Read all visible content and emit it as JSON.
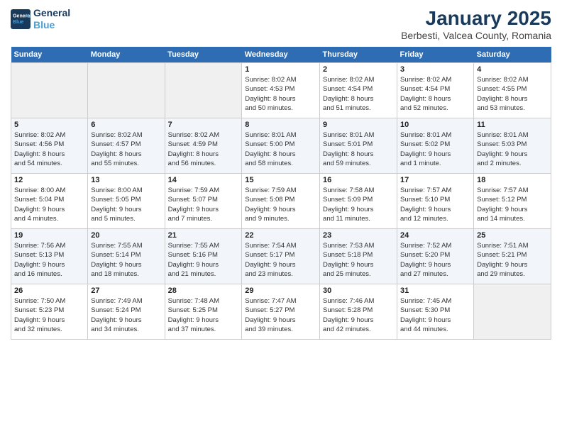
{
  "header": {
    "logo_line1": "General",
    "logo_line2": "Blue",
    "title": "January 2025",
    "subtitle": "Berbesti, Valcea County, Romania"
  },
  "weekdays": [
    "Sunday",
    "Monday",
    "Tuesday",
    "Wednesday",
    "Thursday",
    "Friday",
    "Saturday"
  ],
  "weeks": [
    [
      {
        "day": "",
        "info": ""
      },
      {
        "day": "",
        "info": ""
      },
      {
        "day": "",
        "info": ""
      },
      {
        "day": "1",
        "info": "Sunrise: 8:02 AM\nSunset: 4:53 PM\nDaylight: 8 hours\nand 50 minutes."
      },
      {
        "day": "2",
        "info": "Sunrise: 8:02 AM\nSunset: 4:54 PM\nDaylight: 8 hours\nand 51 minutes."
      },
      {
        "day": "3",
        "info": "Sunrise: 8:02 AM\nSunset: 4:54 PM\nDaylight: 8 hours\nand 52 minutes."
      },
      {
        "day": "4",
        "info": "Sunrise: 8:02 AM\nSunset: 4:55 PM\nDaylight: 8 hours\nand 53 minutes."
      }
    ],
    [
      {
        "day": "5",
        "info": "Sunrise: 8:02 AM\nSunset: 4:56 PM\nDaylight: 8 hours\nand 54 minutes."
      },
      {
        "day": "6",
        "info": "Sunrise: 8:02 AM\nSunset: 4:57 PM\nDaylight: 8 hours\nand 55 minutes."
      },
      {
        "day": "7",
        "info": "Sunrise: 8:02 AM\nSunset: 4:59 PM\nDaylight: 8 hours\nand 56 minutes."
      },
      {
        "day": "8",
        "info": "Sunrise: 8:01 AM\nSunset: 5:00 PM\nDaylight: 8 hours\nand 58 minutes."
      },
      {
        "day": "9",
        "info": "Sunrise: 8:01 AM\nSunset: 5:01 PM\nDaylight: 8 hours\nand 59 minutes."
      },
      {
        "day": "10",
        "info": "Sunrise: 8:01 AM\nSunset: 5:02 PM\nDaylight: 9 hours\nand 1 minute."
      },
      {
        "day": "11",
        "info": "Sunrise: 8:01 AM\nSunset: 5:03 PM\nDaylight: 9 hours\nand 2 minutes."
      }
    ],
    [
      {
        "day": "12",
        "info": "Sunrise: 8:00 AM\nSunset: 5:04 PM\nDaylight: 9 hours\nand 4 minutes."
      },
      {
        "day": "13",
        "info": "Sunrise: 8:00 AM\nSunset: 5:05 PM\nDaylight: 9 hours\nand 5 minutes."
      },
      {
        "day": "14",
        "info": "Sunrise: 7:59 AM\nSunset: 5:07 PM\nDaylight: 9 hours\nand 7 minutes."
      },
      {
        "day": "15",
        "info": "Sunrise: 7:59 AM\nSunset: 5:08 PM\nDaylight: 9 hours\nand 9 minutes."
      },
      {
        "day": "16",
        "info": "Sunrise: 7:58 AM\nSunset: 5:09 PM\nDaylight: 9 hours\nand 11 minutes."
      },
      {
        "day": "17",
        "info": "Sunrise: 7:57 AM\nSunset: 5:10 PM\nDaylight: 9 hours\nand 12 minutes."
      },
      {
        "day": "18",
        "info": "Sunrise: 7:57 AM\nSunset: 5:12 PM\nDaylight: 9 hours\nand 14 minutes."
      }
    ],
    [
      {
        "day": "19",
        "info": "Sunrise: 7:56 AM\nSunset: 5:13 PM\nDaylight: 9 hours\nand 16 minutes."
      },
      {
        "day": "20",
        "info": "Sunrise: 7:55 AM\nSunset: 5:14 PM\nDaylight: 9 hours\nand 18 minutes."
      },
      {
        "day": "21",
        "info": "Sunrise: 7:55 AM\nSunset: 5:16 PM\nDaylight: 9 hours\nand 21 minutes."
      },
      {
        "day": "22",
        "info": "Sunrise: 7:54 AM\nSunset: 5:17 PM\nDaylight: 9 hours\nand 23 minutes."
      },
      {
        "day": "23",
        "info": "Sunrise: 7:53 AM\nSunset: 5:18 PM\nDaylight: 9 hours\nand 25 minutes."
      },
      {
        "day": "24",
        "info": "Sunrise: 7:52 AM\nSunset: 5:20 PM\nDaylight: 9 hours\nand 27 minutes."
      },
      {
        "day": "25",
        "info": "Sunrise: 7:51 AM\nSunset: 5:21 PM\nDaylight: 9 hours\nand 29 minutes."
      }
    ],
    [
      {
        "day": "26",
        "info": "Sunrise: 7:50 AM\nSunset: 5:23 PM\nDaylight: 9 hours\nand 32 minutes."
      },
      {
        "day": "27",
        "info": "Sunrise: 7:49 AM\nSunset: 5:24 PM\nDaylight: 9 hours\nand 34 minutes."
      },
      {
        "day": "28",
        "info": "Sunrise: 7:48 AM\nSunset: 5:25 PM\nDaylight: 9 hours\nand 37 minutes."
      },
      {
        "day": "29",
        "info": "Sunrise: 7:47 AM\nSunset: 5:27 PM\nDaylight: 9 hours\nand 39 minutes."
      },
      {
        "day": "30",
        "info": "Sunrise: 7:46 AM\nSunset: 5:28 PM\nDaylight: 9 hours\nand 42 minutes."
      },
      {
        "day": "31",
        "info": "Sunrise: 7:45 AM\nSunset: 5:30 PM\nDaylight: 9 hours\nand 44 minutes."
      },
      {
        "day": "",
        "info": ""
      }
    ]
  ]
}
